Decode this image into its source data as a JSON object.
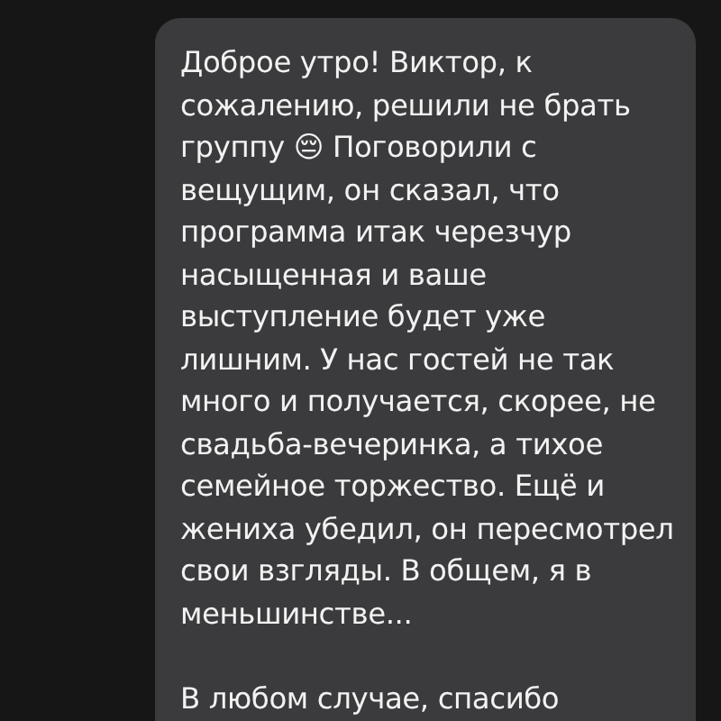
{
  "message": {
    "paragraphs": [
      "Доброе утро! Виктор, к сожалению, решили не брать группу 😔 Поговорили с вещущим, он сказал, что программа итак черезчур насыщенная и ваше выступление будет уже лишним. У нас гостей не так много и получается, скорее, не свадьба-вечеринка, а тихое семейное торжество. Ещё и жениха убедил, он пересмотрел свои взгляды. В общем, я в меньшинстве...",
      "В любом случае, спасибо"
    ]
  }
}
